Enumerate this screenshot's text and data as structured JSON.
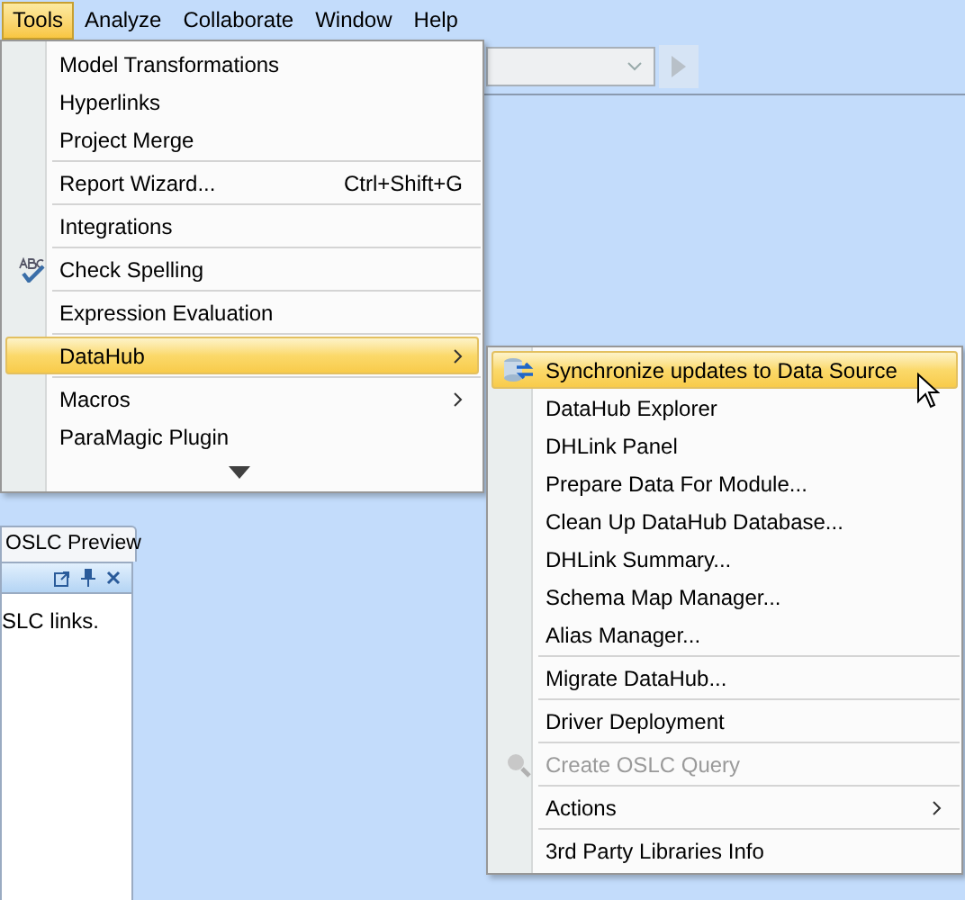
{
  "menubar": [
    {
      "label": "Tools",
      "selected": true
    },
    {
      "label": "Analyze",
      "selected": false
    },
    {
      "label": "Collaborate",
      "selected": false
    },
    {
      "label": "Window",
      "selected": false
    },
    {
      "label": "Help",
      "selected": false
    }
  ],
  "panel": {
    "tab": "OSLC Preview",
    "text": "SLC links."
  },
  "tools_menu": [
    {
      "kind": "item",
      "label": "Model Transformations",
      "selected": false,
      "submenu": false,
      "icon": false
    },
    {
      "kind": "item",
      "label": "Hyperlinks",
      "selected": false,
      "submenu": false,
      "icon": false
    },
    {
      "kind": "item",
      "label": "Project Merge",
      "selected": false,
      "submenu": false,
      "icon": false
    },
    {
      "kind": "separator"
    },
    {
      "kind": "item",
      "label": "Report Wizard...",
      "shortcut": "Ctrl+Shift+G",
      "selected": false,
      "submenu": false,
      "icon": false
    },
    {
      "kind": "separator"
    },
    {
      "kind": "item",
      "label": "Integrations",
      "selected": false,
      "submenu": false,
      "icon": false
    },
    {
      "kind": "separator"
    },
    {
      "kind": "item",
      "label": "Check Spelling",
      "selected": false,
      "submenu": false,
      "icon": true
    },
    {
      "kind": "separator"
    },
    {
      "kind": "item",
      "label": "Expression Evaluation",
      "selected": false,
      "submenu": false,
      "icon": false
    },
    {
      "kind": "separator"
    },
    {
      "kind": "item",
      "label": "DataHub",
      "selected": true,
      "submenu": true,
      "icon": false
    },
    {
      "kind": "separator"
    },
    {
      "kind": "item",
      "label": "Macros",
      "selected": false,
      "submenu": true,
      "icon": false
    },
    {
      "kind": "item",
      "label": "ParaMagic Plugin",
      "selected": false,
      "submenu": false,
      "icon": false
    },
    {
      "kind": "more"
    }
  ],
  "datahub_menu": [
    {
      "kind": "item",
      "label": "Synchronize updates to Data Source",
      "selected": true,
      "submenu": false,
      "disabled": false,
      "icon": true
    },
    {
      "kind": "item",
      "label": "DataHub Explorer",
      "selected": false,
      "submenu": false,
      "disabled": false,
      "icon": false
    },
    {
      "kind": "item",
      "label": "DHLink Panel",
      "selected": false,
      "submenu": false,
      "disabled": false,
      "icon": false
    },
    {
      "kind": "item",
      "label": "Prepare Data For Module...",
      "selected": false,
      "submenu": false,
      "disabled": false,
      "icon": false
    },
    {
      "kind": "item",
      "label": "Clean Up DataHub Database...",
      "selected": false,
      "submenu": false,
      "disabled": false,
      "icon": false
    },
    {
      "kind": "item",
      "label": "DHLink Summary...",
      "selected": false,
      "submenu": false,
      "disabled": false,
      "icon": false
    },
    {
      "kind": "item",
      "label": "Schema Map Manager...",
      "selected": false,
      "submenu": false,
      "disabled": false,
      "icon": false
    },
    {
      "kind": "item",
      "label": "Alias Manager...",
      "selected": false,
      "submenu": false,
      "disabled": false,
      "icon": false
    },
    {
      "kind": "separator"
    },
    {
      "kind": "item",
      "label": "Migrate DataHub...",
      "selected": false,
      "submenu": false,
      "disabled": false,
      "icon": false
    },
    {
      "kind": "separator"
    },
    {
      "kind": "item",
      "label": "Driver Deployment",
      "selected": false,
      "submenu": false,
      "disabled": false,
      "icon": false
    },
    {
      "kind": "separator"
    },
    {
      "kind": "item",
      "label": "Create OSLC Query",
      "selected": false,
      "submenu": false,
      "disabled": true,
      "icon": true
    },
    {
      "kind": "separator"
    },
    {
      "kind": "item",
      "label": "Actions",
      "selected": false,
      "submenu": true,
      "disabled": false,
      "icon": false
    },
    {
      "kind": "separator"
    },
    {
      "kind": "item",
      "label": "3rd Party Libraries Info",
      "selected": false,
      "submenu": false,
      "disabled": false,
      "icon": false
    }
  ]
}
